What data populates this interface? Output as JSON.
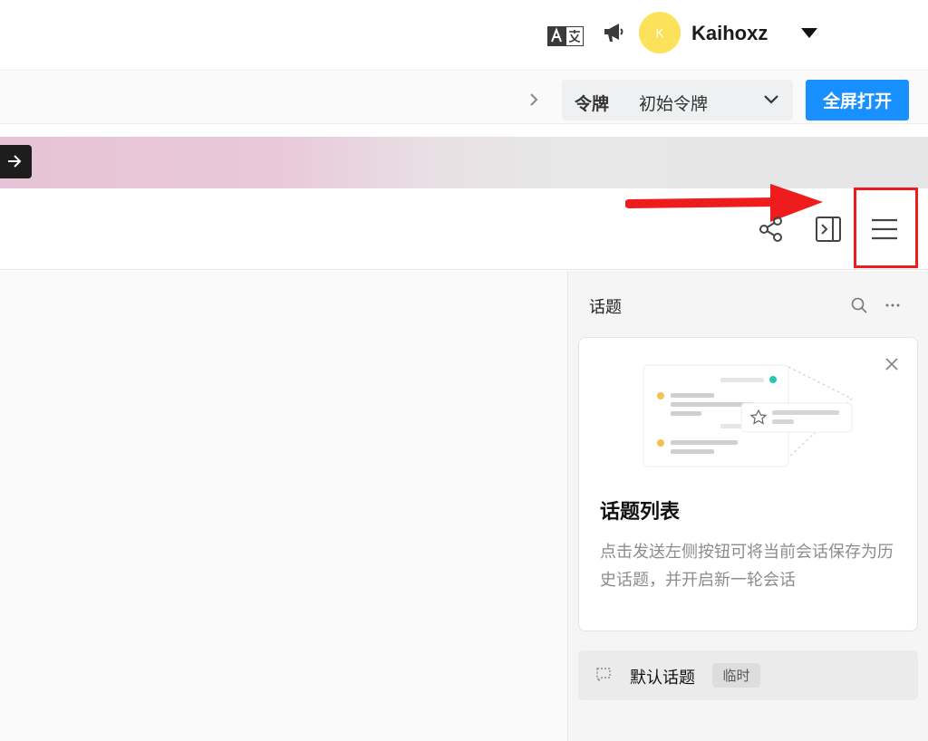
{
  "header": {
    "translate_icon": "translate-icon",
    "announcement_icon": "megaphone-icon",
    "avatar_initial": "K",
    "avatar_color": "#fbe25a",
    "username": "Kaihoxz",
    "dropdown_icon": "caret-down-icon"
  },
  "subbar": {
    "token_label": "令牌",
    "token_value": "初始令牌",
    "fullscreen_label": "全屏打开",
    "accent_color": "#1890ff"
  },
  "toolbar": {
    "share_icon": "share-icon",
    "panel_toggle_icon": "panel-toggle-icon",
    "menu_icon": "hamburger-menu-icon",
    "annotation_color": "#ee1c1c"
  },
  "sidebar": {
    "title": "话题",
    "card": {
      "title": "话题列表",
      "description": "点击发送左侧按钮可将当前会话保存为历史话题，并开启新一轮会话"
    },
    "default_topic": {
      "name": "默认话题",
      "badge": "临时"
    }
  }
}
